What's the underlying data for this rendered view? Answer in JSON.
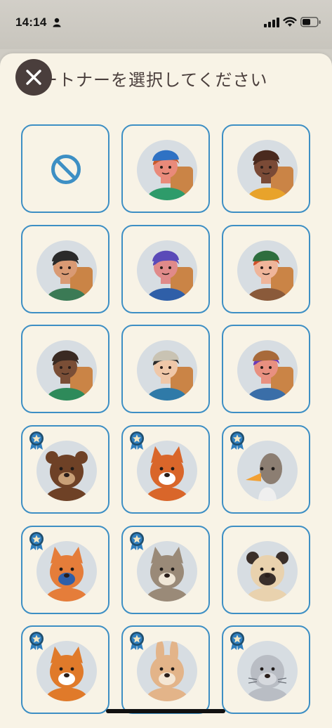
{
  "status_bar": {
    "time": "14:14"
  },
  "sheet": {
    "title": "ートナーを選択してください",
    "close_icon": "close-icon"
  },
  "colors": {
    "accent": "#3d8fc4",
    "sheet_bg": "#f8f3e6",
    "close_bg": "#4a3e3c",
    "avatar_bg": "#d7dde2"
  },
  "partners": [
    {
      "kind": "none",
      "icon": "no-partner-icon",
      "badge": false
    },
    {
      "kind": "hiker-blue-beanie",
      "icon": "hiker-blue-beanie-avatar",
      "badge": false,
      "skin": "#e98a7a",
      "hair": "#c85a2a",
      "hat": "#2f72c4",
      "top": "#2e9b6a"
    },
    {
      "kind": "hiker-curly-hair",
      "icon": "hiker-curly-hair-avatar",
      "badge": false,
      "skin": "#7a4a36",
      "hair": "#4a2a1e",
      "hat": "#4a2a1e",
      "top": "#e8a32b"
    },
    {
      "kind": "hiker-bun",
      "icon": "hiker-bun-avatar",
      "badge": false,
      "skin": "#d99a74",
      "hair": "#2a2a2a",
      "hat": "#2a2a2a",
      "top": "#3b7a55"
    },
    {
      "kind": "hiker-purple-hair",
      "icon": "hiker-purple-hair-avatar",
      "badge": false,
      "skin": "#e08a8a",
      "hair": "#5a4ab8",
      "hat": "#5a4ab8",
      "top": "#2f5fa8"
    },
    {
      "kind": "hiker-green-beanie",
      "icon": "hiker-green-beanie-avatar",
      "badge": false,
      "skin": "#efb59a",
      "hair": "#d0502a",
      "hat": "#2e6e3e",
      "top": "#8a5a3a"
    },
    {
      "kind": "hiker-dreadlocks",
      "icon": "hiker-dreadlocks-avatar",
      "badge": false,
      "skin": "#7a4e36",
      "hair": "#3a2a22",
      "hat": "#3a2a22",
      "top": "#2e8a5a"
    },
    {
      "kind": "hiker-bucket-hat",
      "icon": "hiker-bucket-hat-avatar",
      "badge": false,
      "skin": "#efc7a8",
      "hair": "#2a2a2a",
      "hat": "#c9c3b3",
      "top": "#2f7aa8"
    },
    {
      "kind": "hiker-brown-cap",
      "icon": "hiker-brown-cap-avatar",
      "badge": false,
      "skin": "#e89080",
      "hair": "#6a3ab8",
      "hat": "#a86a3a",
      "top": "#3a6ea8"
    },
    {
      "kind": "bear",
      "icon": "bear-avatar",
      "badge": true,
      "fur": "#6e4126",
      "accent": "#c9a077"
    },
    {
      "kind": "fox",
      "icon": "fox-avatar",
      "badge": true,
      "fur": "#d9662a",
      "accent": "#ffffff"
    },
    {
      "kind": "goose",
      "icon": "goose-avatar",
      "badge": true,
      "fur": "#8c7e72",
      "accent": "#f2a033"
    },
    {
      "kind": "tiger",
      "icon": "tiger-avatar",
      "badge": true,
      "fur": "#e57d3a",
      "accent": "#2f5fa8"
    },
    {
      "kind": "cat",
      "icon": "cat-avatar",
      "badge": true,
      "fur": "#9a8a78",
      "accent": "#efe6d6"
    },
    {
      "kind": "pug",
      "icon": "pug-avatar",
      "badge": false,
      "fur": "#e9d2ae",
      "accent": "#3a2f2a"
    },
    {
      "kind": "corgi",
      "icon": "corgi-avatar",
      "badge": true,
      "fur": "#e07a2a",
      "accent": "#ffffff"
    },
    {
      "kind": "rabbit",
      "icon": "rabbit-avatar",
      "badge": true,
      "fur": "#e3b489",
      "accent": "#f4e6d4"
    },
    {
      "kind": "seal",
      "icon": "seal-avatar",
      "badge": true,
      "fur": "#b9bdc4",
      "accent": "#6b7078"
    }
  ]
}
